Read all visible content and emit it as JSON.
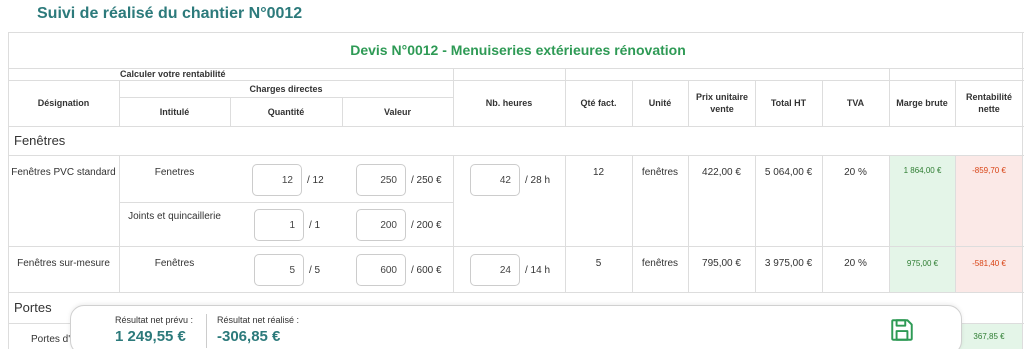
{
  "page": {
    "title": "Suivi de réalisé du chantier N°0012"
  },
  "quote": {
    "title": "Devis N°0012 - Menuiseries extérieures rénovation"
  },
  "headers": {
    "calc": "Calculer votre rentabilité",
    "designation": "Désignation",
    "charges_directes": "Charges directes",
    "intitule": "Intitulé",
    "quantite": "Quantité",
    "valeur": "Valeur",
    "nb_heures": "Nb. heures",
    "qte_fact": "Qté fact.",
    "unite": "Unité",
    "prix_unitaire": "Prix unitaire vente",
    "total_ht": "Total HT",
    "tva": "TVA",
    "marge_brute": "Marge brute",
    "rentabilite_nette": "Rentabilité nette"
  },
  "sections": {
    "fenetres": "Fenêtres",
    "portes": "Portes"
  },
  "rows": [
    {
      "designation": "Fenêtres PVC standard",
      "charges": [
        {
          "intitule": "Fenetres",
          "qty": "12",
          "qty_max": "/ 12",
          "val": "250",
          "val_max": "/ 250 €"
        },
        {
          "intitule": "Joints et quincaillerie",
          "qty": "1",
          "qty_max": "/ 1",
          "val": "200",
          "val_max": "/ 200 €"
        }
      ],
      "heures": "42",
      "heures_max": "/ 28 h",
      "qte_fact": "12",
      "unite": "fenêtres",
      "prix": "422,00 €",
      "total": "5 064,00 €",
      "tva": "20 %",
      "marge": "1 864,00 €",
      "rentabilite": "-859,70 €"
    },
    {
      "designation": "Fenêtres sur-mesure",
      "charges": [
        {
          "intitule": "Fenêtres",
          "qty": "5",
          "qty_max": "/ 5",
          "val": "600",
          "val_max": "/ 600 €"
        }
      ],
      "heures": "24",
      "heures_max": "/ 14 h",
      "qte_fact": "5",
      "unite": "fenêtres",
      "prix": "795,00 €",
      "total": "3 975,00 €",
      "tva": "20 %",
      "marge": "975,00 €",
      "rentabilite": "-581,40 €"
    }
  ],
  "partial_row": {
    "designation": "Portes d'",
    "rentabilite": "367,85 €"
  },
  "footer": {
    "prevu_label": "Résultat net prévu :",
    "prevu_value": "1 249,55 €",
    "realise_label": "Résultat net réalisé :",
    "realise_value": "-306,85 €",
    "save_icon": "floppy-disk-icon"
  },
  "colors": {
    "accent": "#2c7a7b",
    "title_green": "#2e9a55",
    "positive_bg": "#e4f5e8",
    "negative_bg": "#fbe9e7"
  }
}
